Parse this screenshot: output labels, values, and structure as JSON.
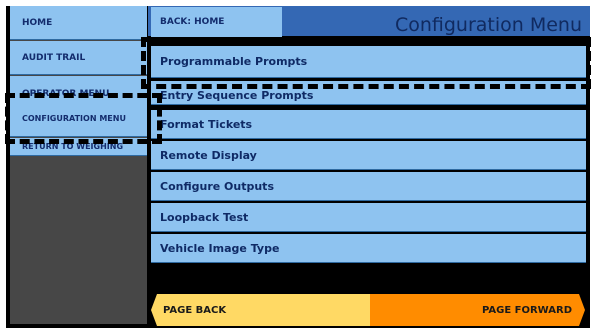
{
  "sidebar": {
    "items": [
      {
        "label": "HOME"
      },
      {
        "label": "AUDIT TRAIL"
      },
      {
        "label": "OPERATOR MENU"
      },
      {
        "label": "CONFIGURATION MENU"
      },
      {
        "label": "RETURN TO WEIGHING"
      }
    ]
  },
  "header": {
    "back_label": "BACK: HOME",
    "title": "Configuration Menu"
  },
  "menu": {
    "items": [
      {
        "label": "Programmable Prompts"
      },
      {
        "label": "Entry Sequence Prompts"
      },
      {
        "label": "Format Tickets"
      },
      {
        "label": "Remote Display"
      },
      {
        "label": "Configure Outputs"
      },
      {
        "label": "Loopback Test"
      },
      {
        "label": "Vehicle Image Type"
      }
    ]
  },
  "footer": {
    "page_back_label": "PAGE BACK",
    "page_forward_label": "PAGE FORWARD"
  },
  "colors": {
    "button_blue": "#8ec3f0",
    "header_blue": "#3468b4",
    "page_back": "#ffd964",
    "page_forward": "#ff8c00",
    "sidebar_bg": "#474747"
  }
}
